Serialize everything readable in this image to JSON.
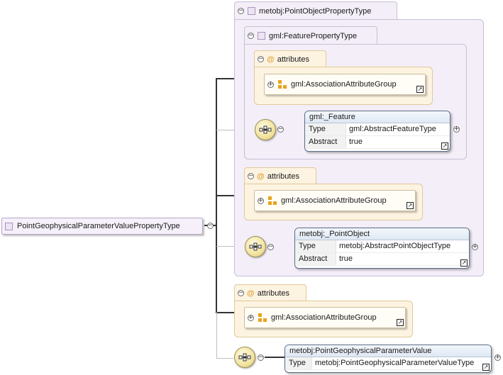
{
  "root": {
    "label": "PointGeophysicalParameterValuePropertyType",
    "toggle": "−"
  },
  "outer_type": {
    "label": "metobj:PointObjectPropertyType",
    "toggle": "−"
  },
  "inner_type": {
    "label": "gml:FeaturePropertyType",
    "toggle": "−"
  },
  "attributes_label": "attributes",
  "group_label": "gml:AssociationAttributeGroup",
  "feature": {
    "name": "gml:_Feature",
    "type_key": "Type",
    "type_value": "gml:AbstractFeatureType",
    "abstract_key": "Abstract",
    "abstract_value": "true"
  },
  "point_object": {
    "name": "metobj:_PointObject",
    "type_key": "Type",
    "type_value": "metobj:AbstractPointObjectType",
    "abstract_key": "Abstract",
    "abstract_value": "true"
  },
  "pgpv": {
    "name": "metobj:PointGeophysicalParameterValue",
    "type_key": "Type",
    "type_value": "metobj:PointGeophysicalParameterValueType"
  },
  "symbols": {
    "collapse": "−",
    "expand": "+",
    "link": "↗"
  },
  "icons": {
    "type": "complex-type-icon",
    "attribute": "at-icon",
    "group": "attribute-group-icon",
    "sequence": "sequence-compositor-icon"
  }
}
